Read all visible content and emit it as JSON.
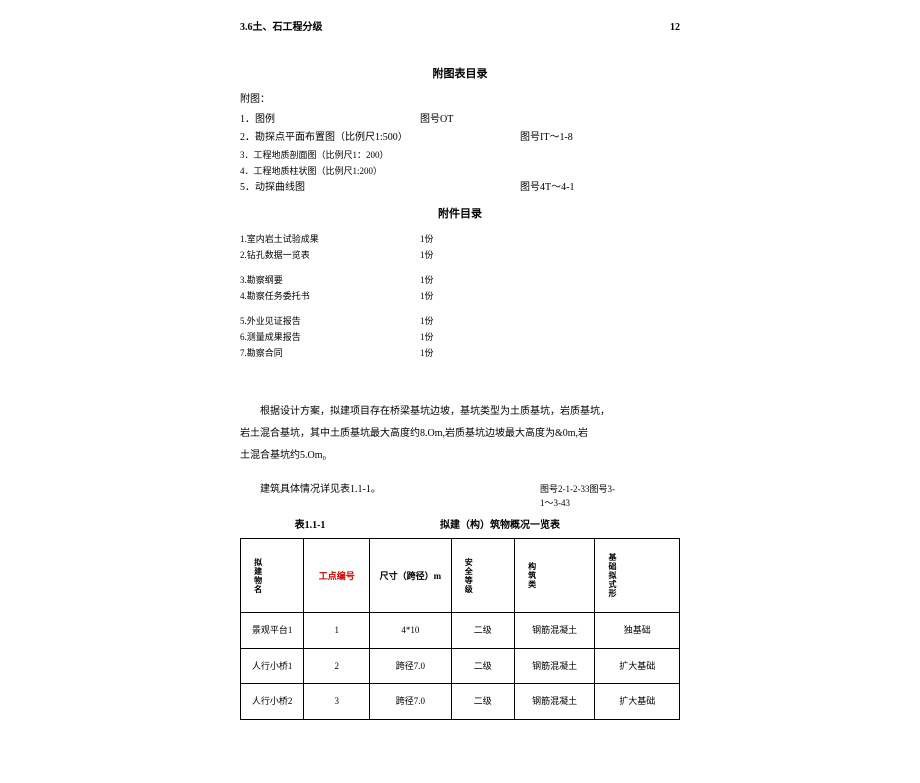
{
  "header": {
    "left": "3.6土、石工程分级",
    "right": "12"
  },
  "figureIndex": {
    "title": "附图表目录",
    "subLabel": "附图：",
    "items": [
      {
        "label": "1．图例",
        "code": "图号OT"
      },
      {
        "label": "2．勘探点平面布置图（比例尺1:500）",
        "code": "图号IT～1-8"
      },
      {
        "label": "3．工程地质剖面图（比例尺1：200）",
        "code": ""
      },
      {
        "label": "4．工程地质柱状图（比例尺1:200）",
        "code": ""
      },
      {
        "label": "5．动探曲线图",
        "code": "图号4T～4-1"
      }
    ]
  },
  "attachIndex": {
    "title": "附件目录",
    "items": [
      {
        "label": "1.室内岩土试验成果",
        "qty": "1份"
      },
      {
        "label": "2.钻孔数据一览表",
        "qty": "1份"
      },
      {
        "label": "3.勘察纲要",
        "qty": "1份"
      },
      {
        "label": "4.勘察任务委托书",
        "qty": "1份"
      },
      {
        "label": "5.外业见证报告",
        "qty": "1份"
      },
      {
        "label": "6.测量成果报告",
        "qty": "1份"
      },
      {
        "label": "7.勘察合同",
        "qty": "1份"
      }
    ]
  },
  "paragraphs": {
    "p1": "根据设计方案，拟建项目存在桥梁基坑边坡，基坑类型为土质基坑，岩质基坑，",
    "p2": "岩土混合基坑，其中土质基坑最大高度约8.Om,岩质基坑边坡最大高度为&0m,岩",
    "p3": "土混合基坑约5.Om₀"
  },
  "tableRef": {
    "left": "建筑具体情况详见表1.1-1。",
    "rightLine1": "图号2-1-2-33图号3-",
    "rightLine2": "1～3-43"
  },
  "table": {
    "num": "表1.1-1",
    "caption": "拟建（构）筑物概况一览表",
    "headers": {
      "h1": "拟建物名",
      "h2": "工点编号",
      "h3": "尺寸（跨径）m",
      "h4": "安全等级",
      "h5": "构筑类",
      "h6": "基础拟式形"
    },
    "rows": [
      {
        "c1": "景观平台1",
        "c2": "1",
        "c3": "4*10",
        "c4": "二级",
        "c5": "钢筋混凝土",
        "c6": "独基础"
      },
      {
        "c1": "人行小桥1",
        "c2": "2",
        "c3": "跨径7.0",
        "c4": "二级",
        "c5": "钢筋混凝土",
        "c6": "扩大基础"
      },
      {
        "c1": "人行小桥2",
        "c2": "3",
        "c3": "跨径7.0",
        "c4": "二级",
        "c5": "钢筋混凝土",
        "c6": "扩大基础"
      }
    ]
  }
}
